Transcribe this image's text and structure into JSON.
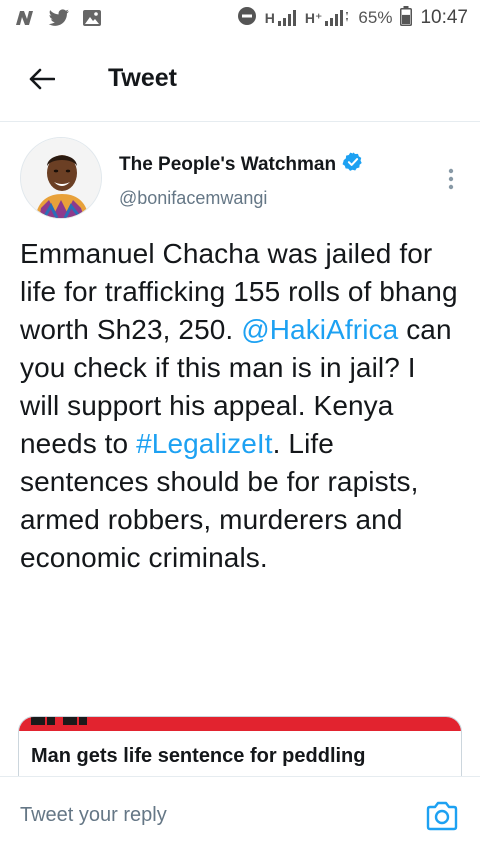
{
  "status_bar": {
    "notification_icons": [
      "n-app-icon",
      "twitter-icon",
      "gallery-icon"
    ],
    "network_1": "H",
    "network_2": "H⁺",
    "battery_percent": "65%",
    "battery_level": 0.65,
    "time": "10:47"
  },
  "header": {
    "title": "Tweet"
  },
  "tweet": {
    "author": {
      "display_name": "The People's Watchman",
      "handle": "@bonifacemwangi",
      "verified": true
    },
    "text_parts": [
      {
        "text": "Emmanuel Chacha was jailed for life for trafficking 155 rolls of bhang worth Sh23, 250. ",
        "link": false
      },
      {
        "text": "@HakiAfrica",
        "link": true
      },
      {
        "text": " can you check if this man is in jail? I will support his appeal. Kenya needs to ",
        "link": false
      },
      {
        "text": "#LegalizeIt",
        "link": true
      },
      {
        "text": ". Life sentences should be for rapists, armed robbers, murderers and economic criminals.",
        "link": false
      }
    ]
  },
  "card": {
    "title": "Man gets life sentence for peddling"
  },
  "reply_bar": {
    "placeholder": "Tweet your reply"
  },
  "colors": {
    "link": "#1da1f2",
    "text": "#14171a",
    "secondary": "#657786",
    "card_brand": "#e2232f"
  }
}
